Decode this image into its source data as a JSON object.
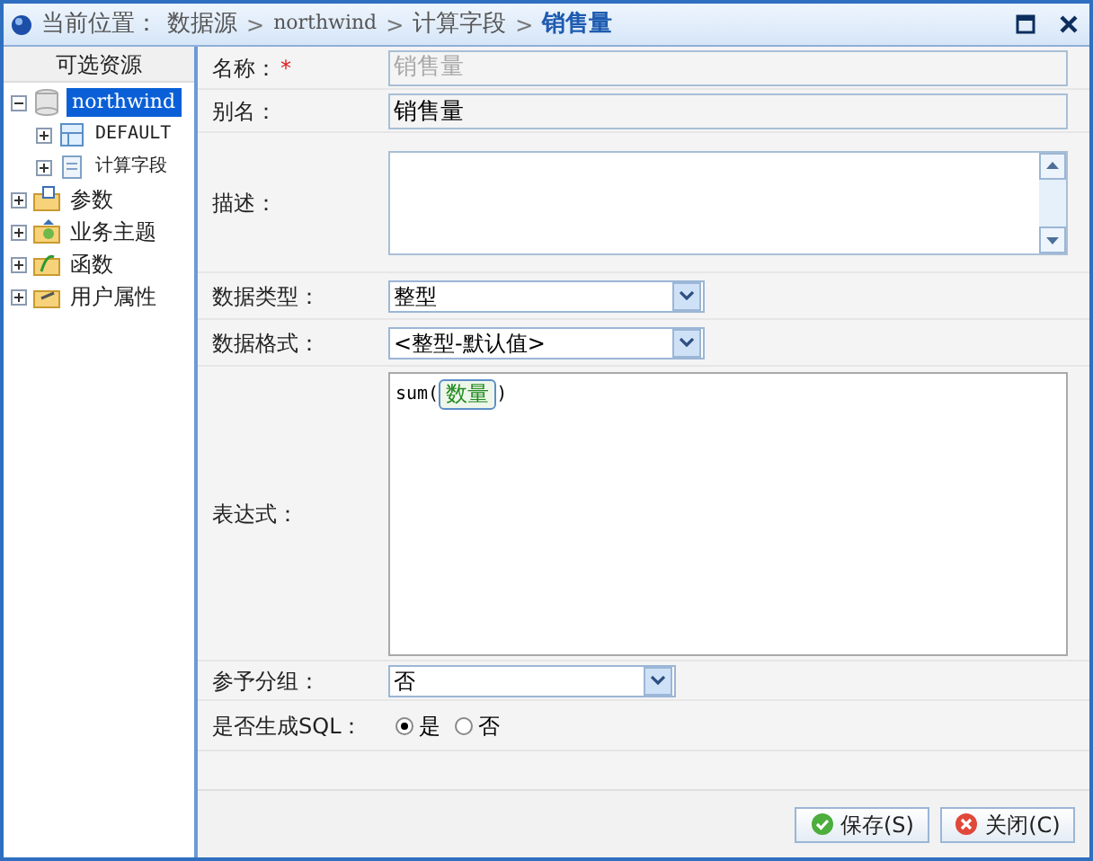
{
  "breadcrumb": {
    "label": "当前位置：",
    "crumbs": [
      {
        "kind": "link",
        "text": "数据源"
      },
      {
        "kind": "separator",
        "text": ">"
      },
      {
        "kind": "link",
        "text": "northwind"
      },
      {
        "kind": "separator",
        "text": ">"
      },
      {
        "kind": "link",
        "text": "计算字段"
      },
      {
        "kind": "separator",
        "text": ">"
      },
      {
        "kind": "current",
        "text": "销售量"
      }
    ]
  },
  "sidebar": {
    "title": "可选资源",
    "tree": [
      {
        "label": "northwind",
        "kind": "database",
        "expanded": true,
        "selected": true,
        "children": [
          {
            "label": "DEFAULT",
            "kind": "table",
            "expanded": false,
            "selected": false
          },
          {
            "label": "计算字段",
            "kind": "document",
            "expanded": false,
            "selected": false
          }
        ]
      },
      {
        "label": "参数",
        "kind": "param",
        "expanded": false,
        "selected": false
      },
      {
        "label": "业务主题",
        "kind": "subject",
        "expanded": false,
        "selected": false
      },
      {
        "label": "函数",
        "kind": "function",
        "expanded": false,
        "selected": false
      },
      {
        "label": "用户属性",
        "kind": "user",
        "expanded": false,
        "selected": false
      }
    ]
  },
  "form": {
    "rows": [
      {
        "kind": "text",
        "label": "名称：",
        "required": "*",
        "placeholder": "销售量"
      },
      {
        "kind": "text",
        "label": "别名：",
        "value": "销售量"
      },
      {
        "kind": "textarea",
        "label": "描述："
      },
      {
        "kind": "select",
        "label": "数据类型：",
        "value": "整型"
      },
      {
        "kind": "select",
        "label": "数据格式：",
        "value": "<整型-默认值>"
      },
      {
        "kind": "expression",
        "label": "表达式：",
        "parts": [
          {
            "kind": "text",
            "text": "sum("
          },
          {
            "kind": "token",
            "text": "数量"
          },
          {
            "kind": "text",
            "text": ")"
          }
        ]
      },
      {
        "kind": "select-wide",
        "label": "参予分组：",
        "value": "否"
      },
      {
        "kind": "radio",
        "label": "是否生成SQL：",
        "options": [
          {
            "label": "是",
            "selected": true
          },
          {
            "label": "否",
            "selected": false
          }
        ]
      }
    ]
  },
  "buttons": [
    {
      "kind": "save",
      "label": "保存(S)"
    },
    {
      "kind": "close",
      "label": "关闭(C)"
    }
  ]
}
